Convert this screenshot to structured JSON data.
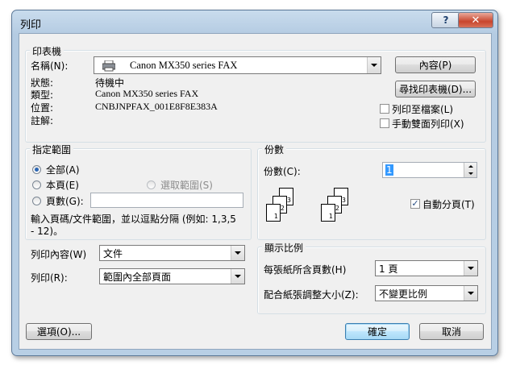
{
  "window": {
    "title": "列印",
    "help": "?",
    "close": "✕"
  },
  "printer": {
    "group_title": "印表機",
    "name_label": "名稱(N):",
    "name_value": "Canon MX350 series FAX",
    "status_label": "狀態:",
    "status_value": "待機中",
    "type_label": "類型:",
    "type_value": "Canon MX350 series FAX",
    "where_label": "位置:",
    "where_value": "CNBJNPFAX_001E8F8E383A",
    "comment_label": "註解:",
    "properties_button": "內容(P)",
    "find_button": "尋找印表機(D)...",
    "print_to_file": "列印至檔案(L)",
    "manual_duplex": "手動雙面列印(X)"
  },
  "range": {
    "group_title": "指定範圍",
    "all": "全部(A)",
    "current": "本頁(E)",
    "selection": "選取範圍(S)",
    "pages": "頁數(G):",
    "pages_value": "",
    "hint": "輸入頁碼/文件範圍，並以逗點分隔 (例如: 1,3,5 - 12)。"
  },
  "copies": {
    "group_title": "份數",
    "label": "份數(C):",
    "value": "1",
    "collate": "自動分頁(T)",
    "collate_icons": [
      "1",
      "2",
      "3",
      "1",
      "2",
      "3"
    ]
  },
  "print_what": {
    "label": "列印內容(W)",
    "value": "文件"
  },
  "print": {
    "label": "列印(R):",
    "value": "範圍內全部頁面"
  },
  "zoom": {
    "group_title": "顯示比例",
    "pages_per_sheet_label": "每張紙所含頁數(H)",
    "pages_per_sheet_value": "1 頁",
    "scale_label": "配合紙張調整大小(Z):",
    "scale_value": "不變更比例"
  },
  "footer": {
    "options": "選項(O)...",
    "ok": "確定",
    "cancel": "取消"
  }
}
